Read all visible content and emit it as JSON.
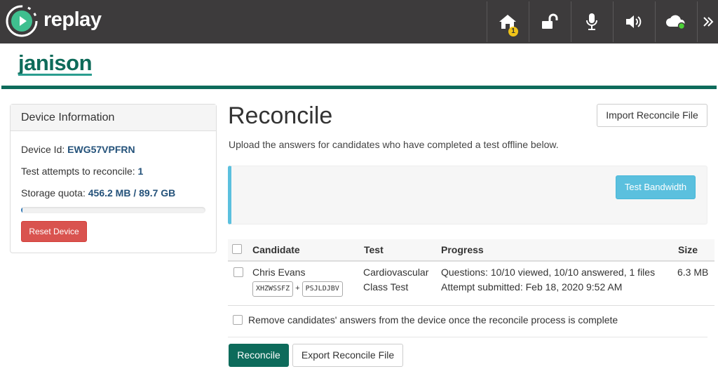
{
  "app": {
    "brand": "replay",
    "org": "janison"
  },
  "topbar": {
    "home_badge": "1",
    "icons": [
      "home-icon",
      "unlock-icon",
      "microphone-icon",
      "speaker-icon",
      "cloud-icon",
      "chevron-double-right-icon"
    ],
    "cloud_status_color": "#4cd137"
  },
  "colors": {
    "topbar": "#3d3b3c",
    "brand_green": "#0d6b5b",
    "danger": "#d9534f",
    "info": "#5bc0de"
  },
  "device": {
    "heading": "Device Information",
    "id_label": "Device Id:",
    "id_value": "EWG57VPFRN",
    "attempts_label": "Test attempts to reconcile:",
    "attempts_value": "1",
    "quota_label": "Storage quota:",
    "quota_value": "456.2 MB / 89.7 GB",
    "quota_fraction": 0.005,
    "reset_label": "Reset Device"
  },
  "main": {
    "title": "Reconcile",
    "import_label": "Import Reconcile File",
    "subtitle": "Upload the answers for candidates who have completed a test offline below.",
    "bandwidth_label": "Test Bandwidth"
  },
  "table": {
    "headers": {
      "candidate": "Candidate",
      "test": "Test",
      "progress": "Progress",
      "size": "Size"
    },
    "rows": [
      {
        "name": "Chris Evans",
        "code1": "XHZWSSFZ",
        "plus": "+",
        "code2": "PSJLDJBV",
        "test_line1": "Cardiovascular",
        "test_line2": "Class Test",
        "progress_line1": "Questions: 10/10 viewed, 10/10 answered, 1 files",
        "progress_line2": "Attempt submitted: Feb 18, 2020 9:52 AM",
        "size": "6.3 MB"
      }
    ]
  },
  "remove_label": "Remove candidates' answers from the device once the reconcile process is complete",
  "actions": {
    "reconcile_label": "Reconcile",
    "export_label": "Export Reconcile File"
  }
}
